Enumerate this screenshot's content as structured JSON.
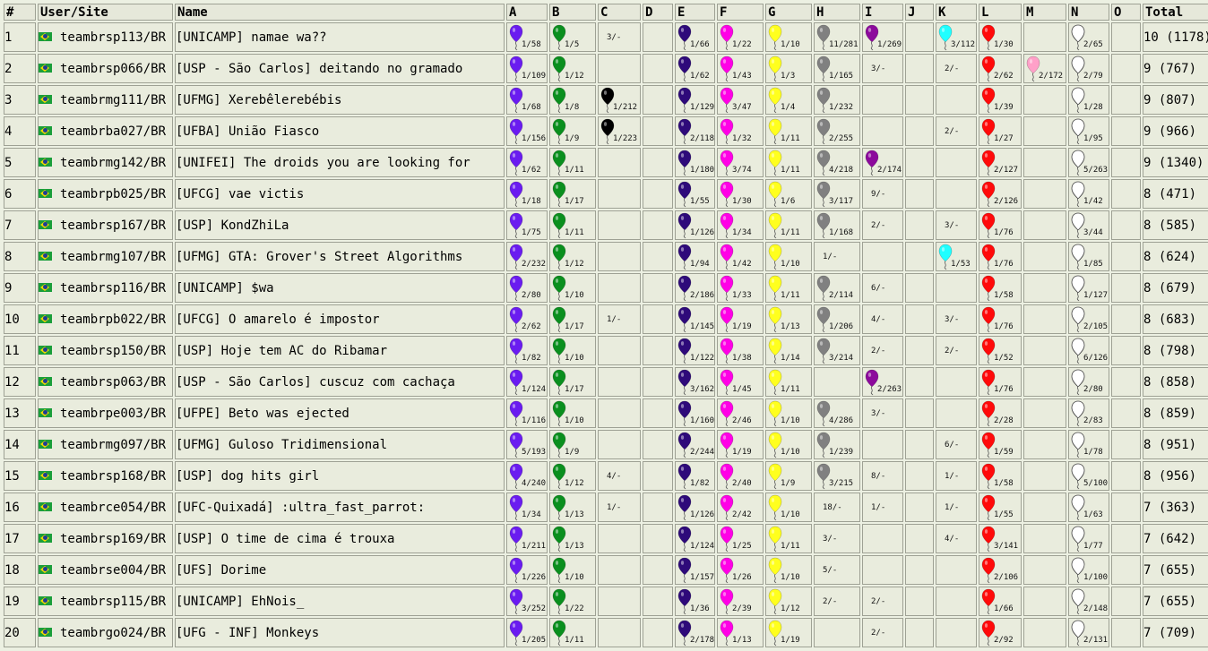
{
  "headers": [
    "#",
    "User/Site",
    "Name",
    "A",
    "B",
    "C",
    "D",
    "E",
    "F",
    "G",
    "H",
    "I",
    "J",
    "K",
    "L",
    "M",
    "N",
    "O",
    "Total"
  ],
  "problem_colors": {
    "A": "#6a1cf0",
    "B": "#0a8f1e",
    "C": "#000000",
    "E": "#2e0a7a",
    "F": "#ff00e6",
    "G": "#ffff1e",
    "H": "#808080",
    "I": "#8c0a9c",
    "K": "#20ffff",
    "L": "#ff0a0a",
    "M": "#ffa0c8",
    "N": "#ffffff"
  },
  "rows": [
    {
      "rank": "1",
      "user": "teambrsp113/BR",
      "name": "[UNICAMP] namae wa??",
      "total": "10 (1178)",
      "cells": {
        "A": "1/58",
        "B": "1/5",
        "C": "3/-",
        "E": "1/66",
        "F": "1/22",
        "G": "1/10",
        "H": "11/281",
        "I": "1/269",
        "K": "3/112",
        "L": "1/30",
        "N": "2/65"
      },
      "solved": [
        "A",
        "B",
        "E",
        "F",
        "G",
        "H",
        "I",
        "K",
        "L",
        "N"
      ]
    },
    {
      "rank": "2",
      "user": "teambrsp066/BR",
      "name": "[USP - São Carlos] deitando no gramado",
      "total": "9 (767)",
      "cells": {
        "A": "1/109",
        "B": "1/12",
        "E": "1/62",
        "F": "1/43",
        "G": "1/3",
        "H": "1/165",
        "I": "3/-",
        "K": "2/-",
        "L": "2/62",
        "M": "2/172",
        "N": "2/79"
      },
      "solved": [
        "A",
        "B",
        "E",
        "F",
        "G",
        "H",
        "L",
        "M",
        "N"
      ]
    },
    {
      "rank": "3",
      "user": "teambrmg111/BR",
      "name": "[UFMG] Xerebêlerebébis",
      "total": "9 (807)",
      "cells": {
        "A": "1/68",
        "B": "1/8",
        "C": "1/212",
        "E": "1/129",
        "F": "3/47",
        "G": "1/4",
        "H": "1/232",
        "L": "1/39",
        "N": "1/28"
      },
      "solved": [
        "A",
        "B",
        "C",
        "E",
        "F",
        "G",
        "H",
        "L",
        "N"
      ]
    },
    {
      "rank": "4",
      "user": "teambrba027/BR",
      "name": "[UFBA] União Fiasco",
      "total": "9 (966)",
      "cells": {
        "A": "1/156",
        "B": "1/9",
        "C": "1/223",
        "E": "2/118",
        "F": "1/32",
        "G": "1/11",
        "H": "2/255",
        "K": "2/-",
        "L": "1/27",
        "N": "1/95"
      },
      "solved": [
        "A",
        "B",
        "C",
        "E",
        "F",
        "G",
        "H",
        "L",
        "N"
      ]
    },
    {
      "rank": "5",
      "user": "teambrmg142/BR",
      "name": "[UNIFEI] The droids you are looking for",
      "total": "9 (1340)",
      "cells": {
        "A": "1/62",
        "B": "1/11",
        "E": "1/180",
        "F": "3/74",
        "G": "1/11",
        "H": "4/218",
        "I": "2/174",
        "L": "2/127",
        "N": "5/263"
      },
      "solved": [
        "A",
        "B",
        "E",
        "F",
        "G",
        "H",
        "I",
        "L",
        "N"
      ]
    },
    {
      "rank": "6",
      "user": "teambrpb025/BR",
      "name": "[UFCG] vae victis",
      "total": "8 (471)",
      "cells": {
        "A": "1/18",
        "B": "1/17",
        "E": "1/55",
        "F": "1/30",
        "G": "1/6",
        "H": "3/117",
        "I": "9/-",
        "L": "2/126",
        "N": "1/42"
      },
      "solved": [
        "A",
        "B",
        "E",
        "F",
        "G",
        "H",
        "L",
        "N"
      ]
    },
    {
      "rank": "7",
      "user": "teambrsp167/BR",
      "name": "[USP] KondZhiLa",
      "total": "8 (585)",
      "cells": {
        "A": "1/75",
        "B": "1/11",
        "E": "1/126",
        "F": "1/34",
        "G": "1/11",
        "H": "1/168",
        "I": "2/-",
        "K": "3/-",
        "L": "1/76",
        "N": "3/44"
      },
      "solved": [
        "A",
        "B",
        "E",
        "F",
        "G",
        "H",
        "L",
        "N"
      ]
    },
    {
      "rank": "8",
      "user": "teambrmg107/BR",
      "name": "[UFMG] GTA: Grover's Street Algorithms",
      "total": "8 (624)",
      "cells": {
        "A": "2/232",
        "B": "1/12",
        "E": "1/94",
        "F": "1/42",
        "G": "1/10",
        "H": "1/-",
        "K": "1/53",
        "L": "1/76",
        "N": "1/85"
      },
      "solved": [
        "A",
        "B",
        "E",
        "F",
        "G",
        "K",
        "L",
        "N"
      ]
    },
    {
      "rank": "9",
      "user": "teambrsp116/BR",
      "name": "[UNICAMP] $wa",
      "total": "8 (679)",
      "cells": {
        "A": "2/80",
        "B": "1/10",
        "E": "2/186",
        "F": "1/33",
        "G": "1/11",
        "H": "2/114",
        "I": "6/-",
        "L": "1/58",
        "N": "1/127"
      },
      "solved": [
        "A",
        "B",
        "E",
        "F",
        "G",
        "H",
        "L",
        "N"
      ]
    },
    {
      "rank": "10",
      "user": "teambrpb022/BR",
      "name": "[UFCG] O amarelo é impostor",
      "total": "8 (683)",
      "cells": {
        "A": "2/62",
        "B": "1/17",
        "C": "1/-",
        "E": "1/145",
        "F": "1/19",
        "G": "1/13",
        "H": "1/206",
        "I": "4/-",
        "K": "3/-",
        "L": "1/76",
        "N": "2/105"
      },
      "solved": [
        "A",
        "B",
        "E",
        "F",
        "G",
        "H",
        "L",
        "N"
      ]
    },
    {
      "rank": "11",
      "user": "teambrsp150/BR",
      "name": "[USP] Hoje tem AC do Ribamar",
      "total": "8 (798)",
      "cells": {
        "A": "1/82",
        "B": "1/10",
        "E": "1/122",
        "F": "1/38",
        "G": "1/14",
        "H": "3/214",
        "I": "2/-",
        "K": "2/-",
        "L": "1/52",
        "N": "6/126"
      },
      "solved": [
        "A",
        "B",
        "E",
        "F",
        "G",
        "H",
        "L",
        "N"
      ]
    },
    {
      "rank": "12",
      "user": "teambrsp063/BR",
      "name": "[USP - São Carlos] cuscuz com cachaça",
      "total": "8 (858)",
      "cells": {
        "A": "1/124",
        "B": "1/17",
        "E": "3/162",
        "F": "1/45",
        "G": "1/11",
        "I": "2/263",
        "L": "1/76",
        "N": "2/80"
      },
      "solved": [
        "A",
        "B",
        "E",
        "F",
        "G",
        "I",
        "L",
        "N"
      ]
    },
    {
      "rank": "13",
      "user": "teambrpe003/BR",
      "name": "[UFPE] Beto was ejected",
      "total": "8 (859)",
      "cells": {
        "A": "1/116",
        "B": "1/10",
        "E": "1/160",
        "F": "2/46",
        "G": "1/10",
        "H": "4/286",
        "I": "3/-",
        "L": "2/28",
        "N": "2/83"
      },
      "solved": [
        "A",
        "B",
        "E",
        "F",
        "G",
        "H",
        "L",
        "N"
      ]
    },
    {
      "rank": "14",
      "user": "teambrmg097/BR",
      "name": "[UFMG] Guloso Tridimensional",
      "total": "8 (951)",
      "cells": {
        "A": "5/193",
        "B": "1/9",
        "E": "2/244",
        "F": "1/19",
        "G": "1/10",
        "H": "1/239",
        "K": "6/-",
        "L": "1/59",
        "N": "1/78"
      },
      "solved": [
        "A",
        "B",
        "E",
        "F",
        "G",
        "H",
        "L",
        "N"
      ]
    },
    {
      "rank": "15",
      "user": "teambrsp168/BR",
      "name": "[USP] dog hits girl",
      "total": "8 (956)",
      "cells": {
        "A": "4/240",
        "B": "1/12",
        "C": "4/-",
        "E": "1/82",
        "F": "2/40",
        "G": "1/9",
        "H": "3/215",
        "I": "8/-",
        "K": "1/-",
        "L": "1/58",
        "N": "5/100"
      },
      "solved": [
        "A",
        "B",
        "E",
        "F",
        "G",
        "H",
        "L",
        "N"
      ]
    },
    {
      "rank": "16",
      "user": "teambrce054/BR",
      "name": "[UFC-Quixadá] :ultra_fast_parrot:",
      "total": "7 (363)",
      "cells": {
        "A": "1/34",
        "B": "1/13",
        "C": "1/-",
        "E": "1/126",
        "F": "2/42",
        "G": "1/10",
        "H": "18/-",
        "I": "1/-",
        "K": "1/-",
        "L": "1/55",
        "N": "1/63"
      },
      "solved": [
        "A",
        "B",
        "E",
        "F",
        "G",
        "L",
        "N"
      ]
    },
    {
      "rank": "17",
      "user": "teambrsp169/BR",
      "name": "[USP] O time de cima é trouxa",
      "total": "7 (642)",
      "cells": {
        "A": "1/211",
        "B": "1/13",
        "E": "1/124",
        "F": "1/25",
        "G": "1/11",
        "H": "3/-",
        "K": "4/-",
        "L": "3/141",
        "N": "1/77"
      },
      "solved": [
        "A",
        "B",
        "E",
        "F",
        "G",
        "L",
        "N"
      ]
    },
    {
      "rank": "18",
      "user": "teambrse004/BR",
      "name": "[UFS] Dorime",
      "total": "7 (655)",
      "cells": {
        "A": "1/226",
        "B": "1/10",
        "E": "1/157",
        "F": "1/26",
        "G": "1/10",
        "H": "5/-",
        "L": "2/106",
        "N": "1/100"
      },
      "solved": [
        "A",
        "B",
        "E",
        "F",
        "G",
        "L",
        "N"
      ]
    },
    {
      "rank": "19",
      "user": "teambrsp115/BR",
      "name": "[UNICAMP] EhNois_",
      "total": "7 (655)",
      "cells": {
        "A": "3/252",
        "B": "1/22",
        "E": "1/36",
        "F": "2/39",
        "G": "1/12",
        "H": "2/-",
        "I": "2/-",
        "L": "1/66",
        "N": "2/148"
      },
      "solved": [
        "A",
        "B",
        "E",
        "F",
        "G",
        "L",
        "N"
      ]
    },
    {
      "rank": "20",
      "user": "teambrgo024/BR",
      "name": "[UFG - INF] Monkeys",
      "total": "7 (709)",
      "cells": {
        "A": "1/205",
        "B": "1/11",
        "E": "2/178",
        "F": "1/13",
        "G": "1/19",
        "I": "2/-",
        "L": "2/92",
        "N": "2/131"
      },
      "solved": [
        "A",
        "B",
        "E",
        "F",
        "G",
        "L",
        "N"
      ]
    }
  ]
}
